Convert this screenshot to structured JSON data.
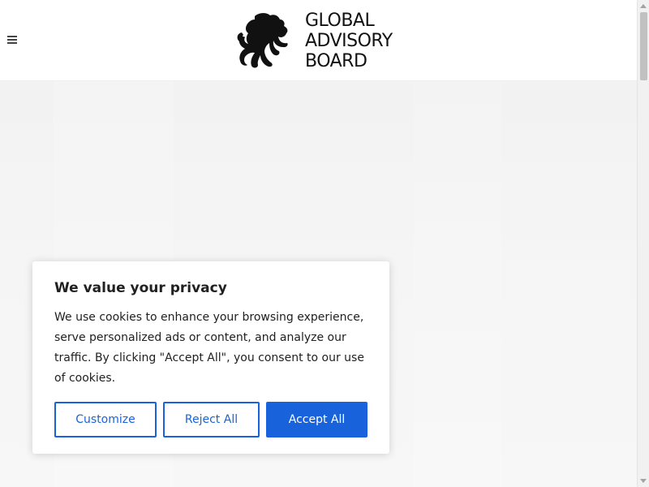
{
  "header": {
    "menu_icon": "hamburger-menu-icon",
    "logo_icon": "rampant-lion-logo",
    "brand_lines": [
      "GLOBAL",
      "ADVISORY",
      "BOARD"
    ]
  },
  "cookie_banner": {
    "title": "We value your privacy",
    "message": "We use cookies to enhance your browsing experience, serve personalized ads or content, and analyze our traffic. By clicking \"Accept All\", you consent to our use of cookies.",
    "buttons": {
      "customize": "Customize",
      "reject": "Reject All",
      "accept": "Accept All"
    }
  },
  "scrollbar": {
    "up_icon": "scroll-up-arrow-icon",
    "down_icon": "scroll-down-arrow-icon"
  },
  "colors": {
    "accent": "#1863dc",
    "text": "#212121",
    "header_bg": "#ffffff",
    "hero_bg": "#f3f3f3"
  }
}
